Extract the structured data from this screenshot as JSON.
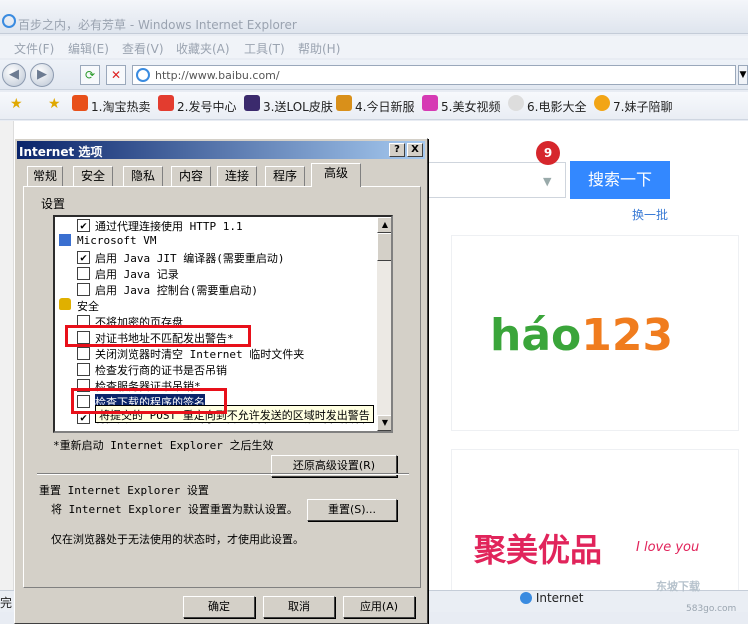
{
  "window": {
    "title": "百步之内，必有芳草 - Windows Internet Explorer",
    "menu": [
      "文件(F)",
      "编辑(E)",
      "查看(V)",
      "收藏夹(A)",
      "工具(T)",
      "帮助(H)"
    ],
    "url": "http://www.baibu.com/"
  },
  "favorites": [
    {
      "label": "1.淘宝热卖",
      "icon": "taobao-icon",
      "color": "#e8501a"
    },
    {
      "label": "2.发号中心",
      "icon": "gift-icon",
      "color": "#e33c2f"
    },
    {
      "label": "3.送LOL皮肤",
      "icon": "lol-icon",
      "color": "#3b2a6d"
    },
    {
      "label": "4.今日新服",
      "icon": "game-icon",
      "color": "#d9901a"
    },
    {
      "label": "5.美女视频",
      "icon": "video-icon",
      "color": "#d63ab4"
    },
    {
      "label": "6.电影大全",
      "icon": "film-icon",
      "color": "#333333"
    },
    {
      "label": "7.妹子陪聊",
      "icon": "chat-icon",
      "color": "#f2a516"
    }
  ],
  "page": {
    "search_button": "搜索一下",
    "badge": "9",
    "change_link": "换一批",
    "ad1_logo": [
      "h",
      "á",
      "o",
      "123"
    ],
    "ad2_logo": "聚美优品",
    "ad2_sub": "I love you"
  },
  "status": {
    "left": "完",
    "zone": "Internet",
    "watermark": "东坡下载",
    "watermark_url": "583go.com"
  },
  "dialog": {
    "title": "Internet 选项",
    "help_btn": "?",
    "close_btn": "X",
    "tabs": [
      "常规",
      "安全",
      "隐私",
      "内容",
      "连接",
      "程序",
      "高级"
    ],
    "active_tab": "高级",
    "settings_label": "设置",
    "settings": [
      {
        "kind": "check",
        "checked": true,
        "indent": 1,
        "text": "通过代理连接使用 HTTP 1.1"
      },
      {
        "kind": "group",
        "icon": "java-icon",
        "text": "Microsoft VM"
      },
      {
        "kind": "check",
        "checked": true,
        "indent": 1,
        "text": "启用 Java JIT 编译器(需要重启动)"
      },
      {
        "kind": "check",
        "checked": false,
        "indent": 1,
        "text": "启用 Java 记录"
      },
      {
        "kind": "check",
        "checked": false,
        "indent": 1,
        "text": "启用 Java 控制台(需要重启动)"
      },
      {
        "kind": "group",
        "icon": "lock-icon",
        "text": "安全"
      },
      {
        "kind": "check",
        "checked": false,
        "indent": 1,
        "text": "不将加密的页存盘"
      },
      {
        "kind": "check",
        "checked": false,
        "indent": 1,
        "text": "对证书地址不匹配发出警告*"
      },
      {
        "kind": "check",
        "checked": false,
        "indent": 1,
        "text": "关闭浏览器时清空 Internet 临时文件夹"
      },
      {
        "kind": "check",
        "checked": false,
        "indent": 1,
        "text": "检查发行商的证书是否吊销"
      },
      {
        "kind": "check",
        "checked": false,
        "indent": 1,
        "text": "检查服务器证书吊销*"
      },
      {
        "kind": "check",
        "checked": false,
        "indent": 1,
        "text": "检查下载的程序的签名"
      },
      {
        "kind": "check",
        "checked": true,
        "indent": 1,
        "text": "将提交的 POST 重定向到不允许发送的区域时发出警告"
      }
    ],
    "tooltip": "将提交的 POST 重定向到不允许发送的区域时发出警告",
    "restart_note": "*重新启动 Internet Explorer 之后生效",
    "restore_btn": "还原高级设置(R)",
    "reset_group": "重置 Internet Explorer 设置",
    "reset_desc": "将 Internet Explorer 设置重置为默认设置。",
    "reset_btn": "重置(S)...",
    "reset_note": "仅在浏览器处于无法使用的状态时，才使用此设置。",
    "ok_btn": "确定",
    "cancel_btn": "取消",
    "apply_btn": "应用(A)"
  }
}
